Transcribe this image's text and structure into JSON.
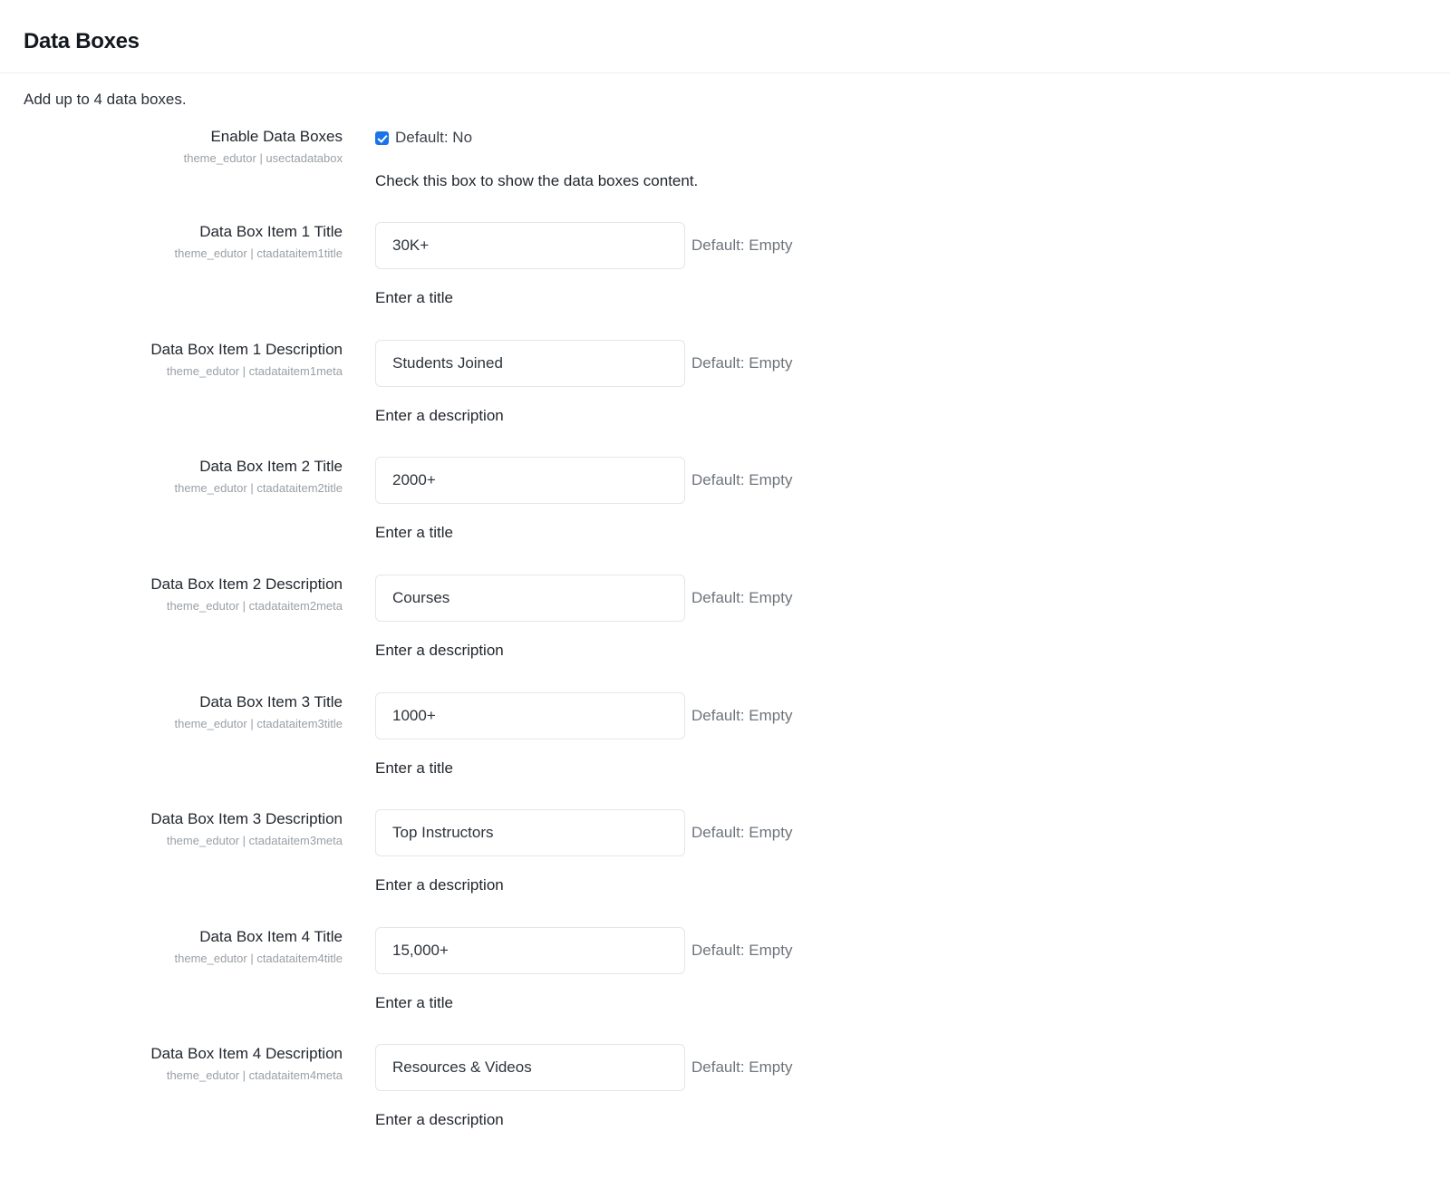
{
  "panel": {
    "title": "Data Boxes",
    "subtitle": "Add up to 4 data boxes."
  },
  "fields": [
    {
      "type": "checkbox",
      "label": "Enable Data Boxes",
      "key": "theme_edutor | usectadatabox",
      "checked": true,
      "checkbox_label": "Default: No",
      "help": "Check this box to show the data boxes content."
    },
    {
      "type": "text",
      "label": "Data Box Item 1 Title",
      "key": "theme_edutor | ctadataitem1title",
      "value": "30K+",
      "placeholder": "",
      "default_note": "Default: Empty",
      "hint": "Enter a title"
    },
    {
      "type": "text",
      "label": "Data Box Item 1 Description",
      "key": "theme_edutor | ctadataitem1meta",
      "value": "Students Joined",
      "placeholder": "",
      "default_note": "Default: Empty",
      "hint": "Enter a description"
    },
    {
      "type": "text",
      "label": "Data Box Item 2 Title",
      "key": "theme_edutor | ctadataitem2title",
      "value": "2000+",
      "placeholder": "",
      "default_note": "Default: Empty",
      "hint": "Enter a title"
    },
    {
      "type": "text",
      "label": "Data Box Item 2 Description",
      "key": "theme_edutor | ctadataitem2meta",
      "value": "Courses",
      "placeholder": "",
      "default_note": "Default: Empty",
      "hint": "Enter a description"
    },
    {
      "type": "text",
      "label": "Data Box Item 3 Title",
      "key": "theme_edutor | ctadataitem3title",
      "value": "1000+",
      "placeholder": "",
      "default_note": "Default: Empty",
      "hint": "Enter a title"
    },
    {
      "type": "text",
      "label": "Data Box Item 3 Description",
      "key": "theme_edutor | ctadataitem3meta",
      "value": "Top Instructors",
      "placeholder": "",
      "default_note": "Default: Empty",
      "hint": "Enter a description"
    },
    {
      "type": "text",
      "label": "Data Box Item 4 Title",
      "key": "theme_edutor | ctadataitem4title",
      "value": "15,000+",
      "placeholder": "",
      "default_note": "Default: Empty",
      "hint": "Enter a title"
    },
    {
      "type": "text",
      "label": "Data Box Item 4 Description",
      "key": "theme_edutor | ctadataitem4meta",
      "value": "Resources & Videos",
      "placeholder": "",
      "default_note": "Default: Empty",
      "hint": "Enter a description"
    }
  ],
  "colors": {
    "accent": "#1a73e8",
    "text": "#22272e",
    "muted": "#9aa0a6",
    "border": "#e3e6e8",
    "divider": "#eceef0"
  }
}
